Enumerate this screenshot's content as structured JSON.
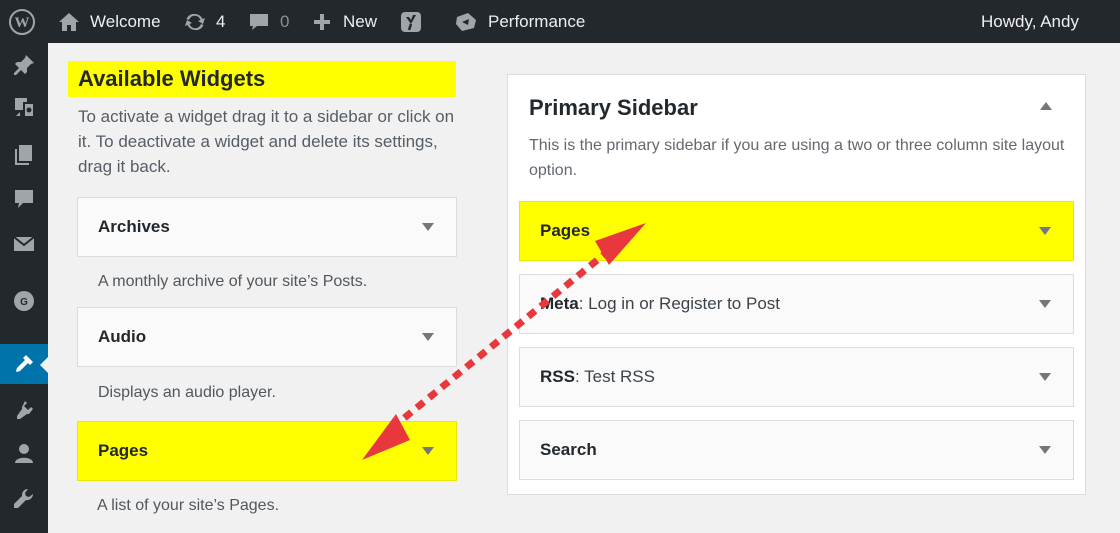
{
  "adminbar": {
    "site_name": "Welcome",
    "updates_count": "4",
    "comments_count": "0",
    "new_label": "New",
    "performance_label": "Performance",
    "howdy": "Howdy, Andy"
  },
  "sidemenu": {
    "icons": [
      "pin-icon",
      "media-icon",
      "pages-icon",
      "comments-icon",
      "mail-icon",
      "g-icon",
      "appearance-icon",
      "plugins-icon",
      "users-icon",
      "tools-icon"
    ],
    "current": "appearance-icon"
  },
  "available": {
    "title": "Available Widgets",
    "description": "To activate a widget drag it to a sidebar or click on it. To deactivate a widget and delete its settings, drag it back.",
    "widgets": [
      {
        "title": "Archives",
        "description": "A monthly archive of your site’s Posts."
      },
      {
        "title": "Audio",
        "description": "Displays an audio player."
      },
      {
        "title": "Pages",
        "description": "A list of your site’s Pages."
      }
    ]
  },
  "sidebar": {
    "title": "Primary Sidebar",
    "description": "This is the primary sidebar if you are using a two or three column site layout option.",
    "widgets": [
      {
        "title": "Pages",
        "subtitle": ""
      },
      {
        "title": "Meta",
        "subtitle": ": Log in or Register to Post"
      },
      {
        "title": "RSS",
        "subtitle": ": Test RSS"
      },
      {
        "title": "Search",
        "subtitle": ""
      }
    ]
  },
  "colors": {
    "highlight": "#ffff00",
    "arrow": "#e8383d",
    "adminbar": "#23282d",
    "accent": "#0073aa"
  }
}
